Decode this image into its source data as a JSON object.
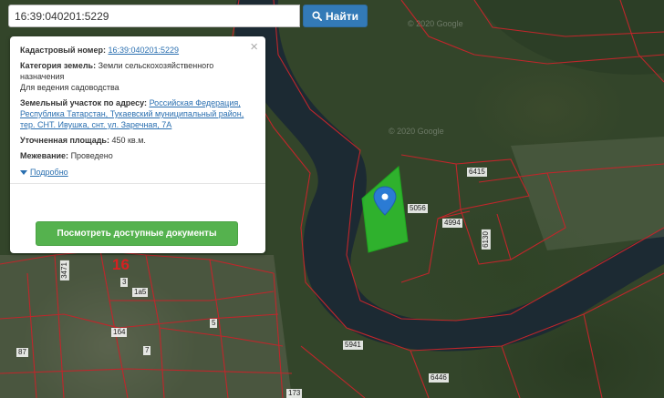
{
  "search": {
    "value": "16:39:040201:5229",
    "button_label": "Найти",
    "button_icon": "search-icon"
  },
  "info": {
    "cadastral_label": "Кадастровый номер:",
    "cadastral_value": "16:39:040201:5229",
    "category_label": "Категория земель:",
    "category_value": "Земли сельскохозяйственного назначения",
    "usage_value": "Для ведения садоводства",
    "address_label": "Земельный участок по адресу:",
    "address_value": "Российская Федерация, Республика Татарстан, Тукаевский муниципальный район, тер. СНТ. Ивушка, снт. ул. Заречная, 7А",
    "area_label": "Уточненная площадь:",
    "area_value": "450 кв.м.",
    "survey_label": "Межевание:",
    "survey_value": "Проведено",
    "details_label": "Подробно",
    "close_symbol": "×",
    "docs_button_label": "Посмотреть доступные документы"
  },
  "map": {
    "watermark_1": "© 2020 Google",
    "watermark_2": "© 2020 Google",
    "block_label": "16",
    "plot_labels": [
      "6415",
      "5056",
      "4994",
      "6130",
      "3471",
      "3",
      "1а5",
      "1б4",
      "5",
      "7",
      "87",
      "5941",
      "6446",
      "173"
    ],
    "colors": {
      "parcel_border": "#c0262b",
      "selected_parcel": "#2ecc2e",
      "marker": "#2b7bd4",
      "river": "#1c2a33"
    }
  }
}
